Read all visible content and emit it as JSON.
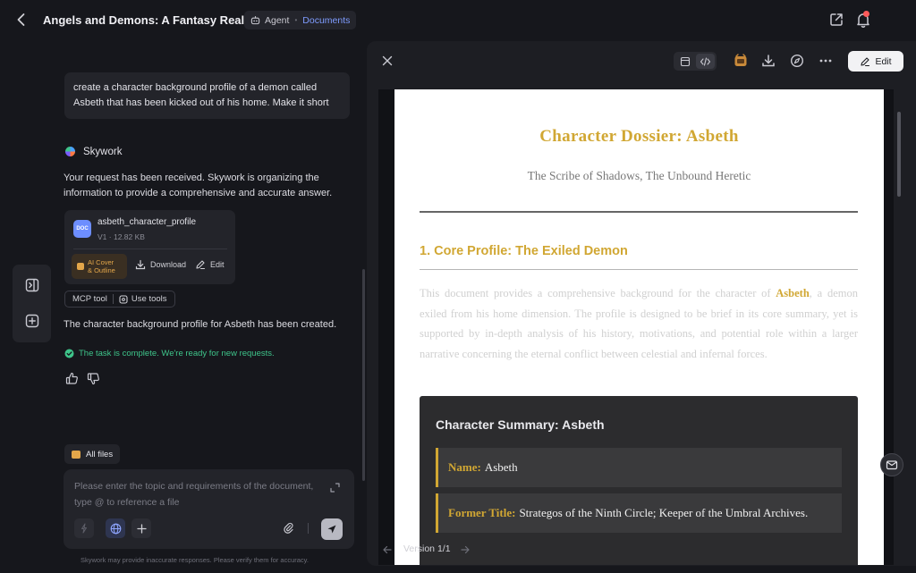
{
  "header": {
    "title": "Angels and Demons: A Fantasy Realm",
    "mode_agent": "Agent",
    "mode_documents": "Documents"
  },
  "chat": {
    "user_message": "create a character background profile of a demon called Asbeth that has been kicked out of his home. Make it short",
    "bot_name": "Skywork",
    "bot_message": "Your request has been received. Skywork is organizing the information to provide a comprehensive and accurate answer.",
    "file": {
      "icon_text": "DOC",
      "name": "asbeth_character_profile",
      "version": "V1",
      "size": "12.82 KB",
      "ai_cover_line1": "AI Cover",
      "ai_cover_line2": "& Outline",
      "download_label": "Download",
      "edit_label": "Edit"
    },
    "tools": {
      "mcp_label": "MCP tool",
      "use_tools_label": "Use tools"
    },
    "completion_message": "The character background profile for Asbeth has been created.",
    "status": "The task is complete. We're ready for new requests.",
    "all_files_label": "All files",
    "input_placeholder": "Please enter the topic and requirements of the document, type @ to reference a file",
    "disclaimer": "Skywork may provide inaccurate responses. Please verify them for accuracy."
  },
  "document": {
    "edit_label": "Edit",
    "title": "Character Dossier: Asbeth",
    "subtitle": "The Scribe of Shadows, The Unbound Heretic",
    "section1_heading": "1. Core Profile: The Exiled Demon",
    "intro_before": "This document provides a comprehensive background for the character of ",
    "intro_highlight": "Asbeth",
    "intro_after": ", a demon exiled from his home dimension. The profile is designed to be brief in its core summary, yet is supported by in-depth analysis of his history, motivations, and potential role within a larger narrative concerning the eternal conflict between celestial and infernal forces.",
    "summary_title": "Character Summary: Asbeth",
    "fields": [
      {
        "label": "Name:",
        "value": "Asbeth"
      },
      {
        "label": "Former Title:",
        "value": "Strategos of the Ninth Circle; Keeper of the Umbral Archives."
      }
    ],
    "version_label": "Version 1/1"
  },
  "colors": {
    "accent_gold": "#d1a733",
    "accent_blue": "#7f9cff",
    "success_green": "#3ec48a"
  },
  "icons": {
    "back": "chevron-left-icon",
    "share": "external-link-icon",
    "bell": "bell-icon",
    "close": "close-icon",
    "download": "download-icon",
    "compass": "compass-icon",
    "more": "more-dots-icon"
  }
}
